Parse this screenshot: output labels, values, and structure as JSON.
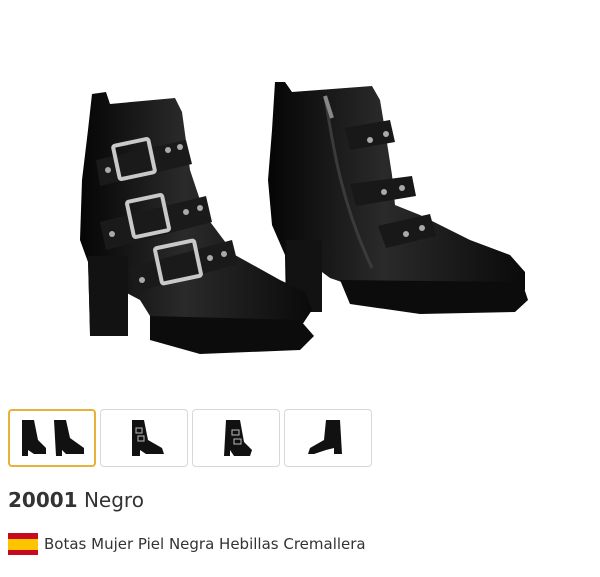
{
  "product": {
    "code": "20001",
    "color": "Negro",
    "description": "Botas Mujer Piel Negra Hebillas Cremallera"
  },
  "gallery": {
    "selected_index": 0,
    "thumbnails": [
      {
        "name": "thumb-pair-view"
      },
      {
        "name": "thumb-side-buckle-view"
      },
      {
        "name": "thumb-front-view"
      },
      {
        "name": "thumb-inner-zip-view"
      }
    ]
  },
  "flag": {
    "country": "Spain",
    "colors": [
      "#c60b1e",
      "#ffc400"
    ]
  },
  "colors": {
    "accent_border": "#e8b13a",
    "boot": "#111111"
  }
}
